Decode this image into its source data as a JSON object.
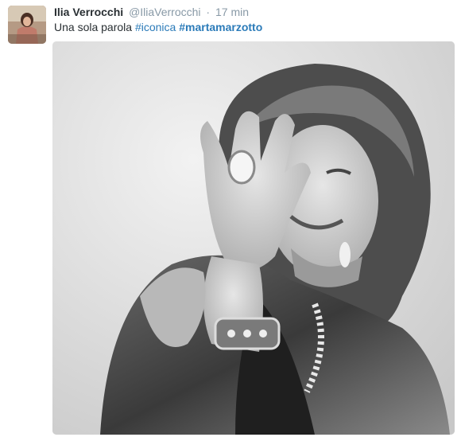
{
  "tweet": {
    "author_name": "Ilia Verrocchi",
    "author_handle": "@IliaVerrocchi",
    "separator": "·",
    "timestamp": "17 min",
    "text_prefix": "Una sola parola",
    "hashtags": [
      "#iconica",
      "#martamarzotto"
    ]
  },
  "icons": {
    "avatar": "user-avatar-photo",
    "media": "portrait-photo"
  },
  "colors": {
    "name": "#292f33",
    "meta": "#8899a6",
    "link": "#2b7bb9"
  }
}
